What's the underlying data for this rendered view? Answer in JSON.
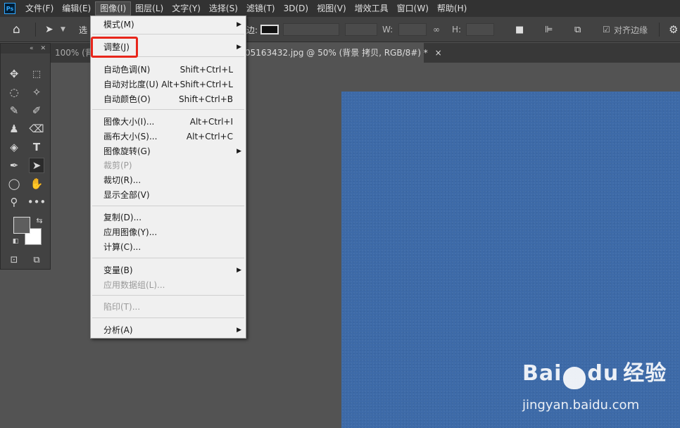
{
  "menubar": {
    "logo": "Ps",
    "items": [
      "文件(F)",
      "编辑(E)",
      "图像(I)",
      "图层(L)",
      "文字(Y)",
      "选择(S)",
      "滤镜(T)",
      "3D(D)",
      "视图(V)",
      "增效工具",
      "窗口(W)",
      "帮助(H)"
    ]
  },
  "optionsbar": {
    "select_label": "选",
    "stroke_label": "边:",
    "w_label": "W:",
    "h_label": "H:",
    "align_edges": "对齐边缘"
  },
  "tabs": {
    "left": "100% (背",
    "active": "05163432.jpg @ 50% (背景 拷贝, RGB/8#) *",
    "close": "×"
  },
  "image_menu": {
    "items": [
      {
        "label": "模式(M)",
        "shortcut": "",
        "submenu": true,
        "disabled": false
      },
      {
        "label": "调整(J)",
        "shortcut": "",
        "submenu": true,
        "disabled": false
      },
      {
        "label": "自动色调(N)",
        "shortcut": "Shift+Ctrl+L",
        "submenu": false,
        "disabled": false
      },
      {
        "label": "自动对比度(U)",
        "shortcut": "Alt+Shift+Ctrl+L",
        "submenu": false,
        "disabled": false
      },
      {
        "label": "自动颜色(O)",
        "shortcut": "Shift+Ctrl+B",
        "submenu": false,
        "disabled": false
      },
      {
        "label": "图像大小(I)...",
        "shortcut": "Alt+Ctrl+I",
        "submenu": false,
        "disabled": false
      },
      {
        "label": "画布大小(S)...",
        "shortcut": "Alt+Ctrl+C",
        "submenu": false,
        "disabled": false
      },
      {
        "label": "图像旋转(G)",
        "shortcut": "",
        "submenu": true,
        "disabled": false
      },
      {
        "label": "裁剪(P)",
        "shortcut": "",
        "submenu": false,
        "disabled": true
      },
      {
        "label": "裁切(R)...",
        "shortcut": "",
        "submenu": false,
        "disabled": false
      },
      {
        "label": "显示全部(V)",
        "shortcut": "",
        "submenu": false,
        "disabled": false
      },
      {
        "label": "复制(D)...",
        "shortcut": "",
        "submenu": false,
        "disabled": false
      },
      {
        "label": "应用图像(Y)...",
        "shortcut": "",
        "submenu": false,
        "disabled": false
      },
      {
        "label": "计算(C)...",
        "shortcut": "",
        "submenu": false,
        "disabled": false
      },
      {
        "label": "变量(B)",
        "shortcut": "",
        "submenu": true,
        "disabled": false
      },
      {
        "label": "应用数据组(L)...",
        "shortcut": "",
        "submenu": false,
        "disabled": true
      },
      {
        "label": "陷印(T)...",
        "shortcut": "",
        "submenu": false,
        "disabled": true
      },
      {
        "label": "分析(A)",
        "shortcut": "",
        "submenu": true,
        "disabled": false
      }
    ]
  },
  "watermark": {
    "brand_left": "Bai",
    "brand_right": "du",
    "brand_cn": "经验",
    "url": "jingyan.baidu.com"
  },
  "colors": {
    "highlight": "#e8261b",
    "canvas": "#3d6aa8"
  }
}
